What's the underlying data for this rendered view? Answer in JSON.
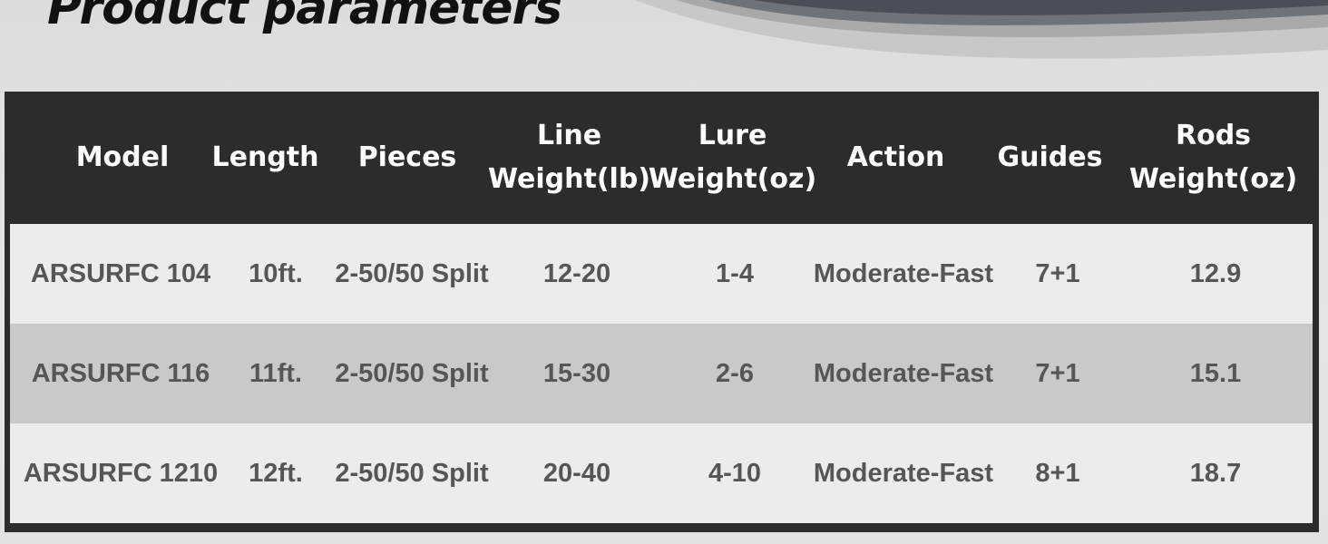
{
  "page_title": "Product parameters",
  "table": {
    "headers": [
      {
        "line1": "Model",
        "line2": ""
      },
      {
        "line1": "Length",
        "line2": ""
      },
      {
        "line1": "Pieces",
        "line2": ""
      },
      {
        "line1": "Line",
        "line2": "Weight(lb)"
      },
      {
        "line1": "Lure",
        "line2": "Weight(oz)"
      },
      {
        "line1": "Action",
        "line2": ""
      },
      {
        "line1": "Guides",
        "line2": ""
      },
      {
        "line1": "Rods",
        "line2": "Weight(oz)"
      }
    ],
    "rows": [
      [
        "ARSURFC 104",
        "10ft.",
        "2-50/50 Split",
        "12-20",
        "1-4",
        "Moderate-Fast",
        "7+1",
        "12.9"
      ],
      [
        "ARSURFC 116",
        "11ft.",
        "2-50/50 Split",
        "15-30",
        "2-6",
        "Moderate-Fast",
        "7+1",
        "15.1"
      ],
      [
        "ARSURFC 1210",
        "12ft.",
        "2-50/50 Split",
        "20-40",
        "4-10",
        "Moderate-Fast",
        "8+1",
        "18.7"
      ]
    ]
  },
  "colors": {
    "header_bg": "#2d2c2d",
    "header_text": "#ffffff",
    "row_light": "#ececee",
    "row_mid": "#c9c9cb",
    "cell_text": "#565656"
  }
}
